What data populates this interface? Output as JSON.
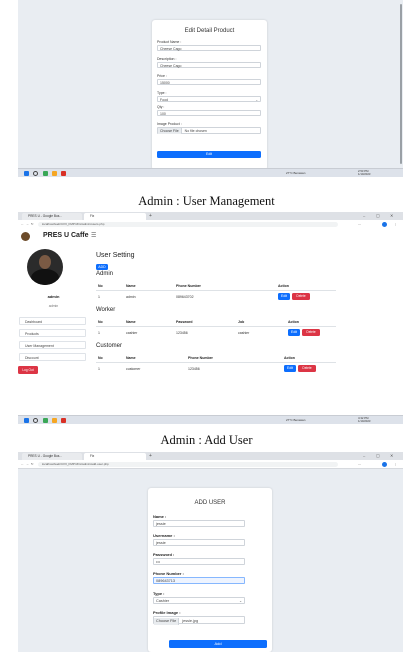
{
  "shot1": {
    "card_title": "Edit Detail Product",
    "fields": [
      {
        "label": "Product Name :",
        "value": "Cheese Cago"
      },
      {
        "label": "Description :",
        "value": "Cheese Cago"
      },
      {
        "label": "Price :",
        "value": "15000"
      },
      {
        "label": "Type :",
        "value": "Food"
      },
      {
        "label": "Qty :",
        "value": "100"
      }
    ],
    "image_label": "Image Product :",
    "choose_file": "Choose File",
    "no_file": "No file chosen",
    "submit": "Edit",
    "taskbar": {
      "weather": "27°C Berawan",
      "time": "2:53 PM",
      "date": "1/10/2023"
    }
  },
  "caption1": "Admin : User Management",
  "shot2": {
    "tab1": "PRES U - Google Bus...",
    "tab2": "Fix",
    "url": "localhost/web/CIVI_FMPrJFix/admin/users.php",
    "brand": "PRES U Caffe",
    "user_name": "admin",
    "user_role": "admin",
    "nav": [
      "Dashboard",
      "Products",
      "User Management",
      "Discount"
    ],
    "logout": "Log Out",
    "page_title": "User Setting",
    "add_button": "ADD",
    "admin": {
      "title": "Admin",
      "headers": [
        "No",
        "Name",
        "Phone Number",
        "Action"
      ],
      "rows": [
        [
          "1",
          "admin",
          "089643702"
        ]
      ]
    },
    "worker": {
      "title": "Worker",
      "headers": [
        "No",
        "Name",
        "Password",
        "Job",
        "Action"
      ],
      "rows": [
        [
          "1",
          "cashier",
          "123456",
          "cashier"
        ]
      ]
    },
    "customer": {
      "title": "Customer",
      "headers": [
        "No",
        "Name",
        "Phone Number",
        "Action"
      ],
      "rows": [
        [
          "1",
          "customer",
          "123456"
        ]
      ]
    },
    "edit": "Edit",
    "delete": "Delete",
    "taskbar": {
      "weather": "27°C Berawan",
      "time": "4:32 PM",
      "date": "1/10/2023"
    }
  },
  "caption2": "Admin : Add User",
  "shot3": {
    "tab1": "PRES U - Google Bus...",
    "tab2": "Fix",
    "url": "localhost/web/CIVI_FMPrJFix/admin/add-user.php",
    "card_title": "ADD USER",
    "fields": [
      {
        "label": "Name :",
        "value": "jessie"
      },
      {
        "label": "Username :",
        "value": "jessie"
      },
      {
        "label": "Password :",
        "value": "•••"
      },
      {
        "label": "Phone Number :",
        "value": "089643713"
      }
    ],
    "type_label": "Type :",
    "type_value": "Cashier",
    "image_label": "Profile Image :",
    "choose_file": "Choose File",
    "file_name": "jessie.jpg",
    "submit": "Add"
  },
  "colors": {
    "primary": "#0d6efd",
    "danger": "#dc3545"
  }
}
